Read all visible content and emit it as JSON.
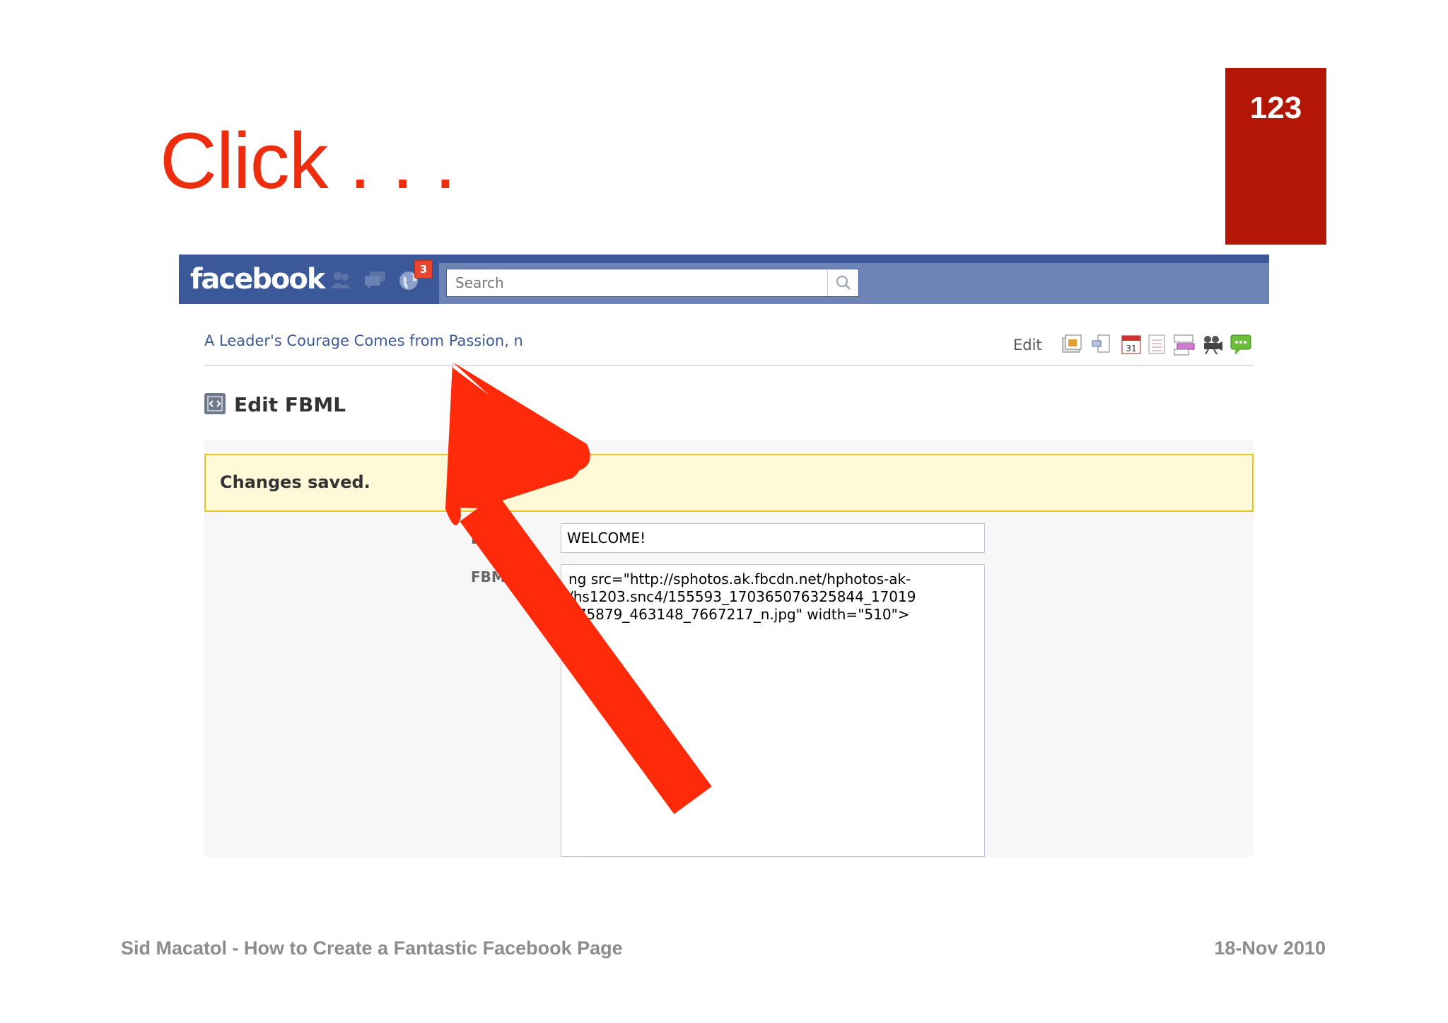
{
  "slide": {
    "title": "Click . . .",
    "page_number": "123",
    "footer_left": "Sid Macatol - How to Create a Fantastic Facebook Page",
    "footer_right": "18-Nov 2010"
  },
  "facebook": {
    "logo": "facebook",
    "notification_count": "3",
    "search_placeholder": "Search",
    "jewels": [
      "friends-icon",
      "messages-icon",
      "notifications-icon"
    ],
    "page_link": "A Leader's Courage Comes from Passion, n",
    "edit_label": "Edit",
    "toolbar_icons": [
      "photos-icon",
      "share-icon",
      "calendar-icon",
      "notes-icon",
      "discussions-icon",
      "video-icon",
      "chat-icon"
    ],
    "section_title": "Edit FBML",
    "notice": "Changes saved.",
    "box_title_label": "Box Tit",
    "box_title_value": "WELCOME!",
    "fbml_label": "FBML:",
    "fbml_value": "ng src=\"http://sphotos.ak.fbcdn.net/hphotos-ak-\n/hs1203.snc4/155593_170365076325844_17019\n575879_463148_7667217_n.jpg\" width=\"510\">"
  },
  "colors": {
    "title_red": "#ee2d0f",
    "page_box": "#b31605",
    "fb_blue": "#3b5998",
    "arrow_red": "#ff2a0a"
  }
}
